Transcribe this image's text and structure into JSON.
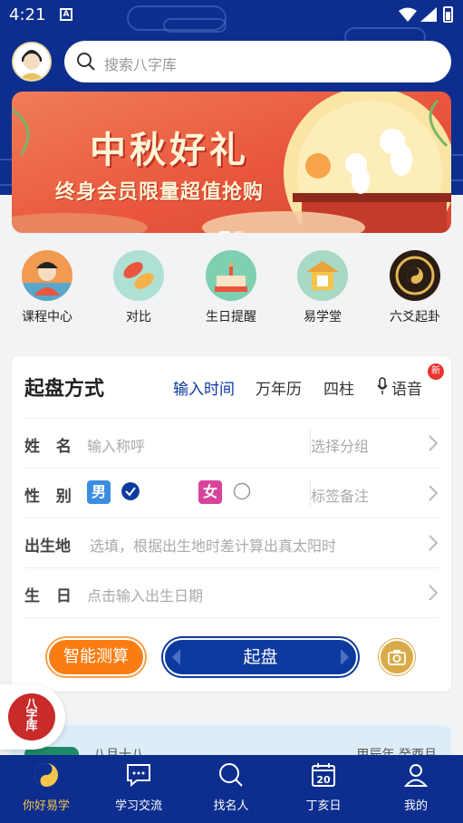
{
  "status": {
    "time": "4:21"
  },
  "search": {
    "placeholder": "搜索八字库"
  },
  "banner": {
    "title": "中秋好礼",
    "subtitle": "终身会员限量超值抢购"
  },
  "shortcuts": [
    {
      "label": "课程中心",
      "icon": "teacher-icon"
    },
    {
      "label": "对比",
      "icon": "koi-fish-icon"
    },
    {
      "label": "生日提醒",
      "icon": "birthday-cake-icon"
    },
    {
      "label": "易学堂",
      "icon": "temple-icon"
    },
    {
      "label": "六爻起卦",
      "icon": "bagua-icon"
    }
  ],
  "form": {
    "title": "起盘方式",
    "tabs": [
      "输入时间",
      "万年历",
      "四柱",
      "语音"
    ],
    "active_tab": "输入时间",
    "new_badge": "新",
    "name_label": "姓 名",
    "name_placeholder": "输入称呼",
    "group_placeholder": "选择分组",
    "gender_label": "性 别",
    "male": "男",
    "female": "女",
    "selected_gender": "男",
    "tag_placeholder": "标签备注",
    "birthplace_label": "出生地",
    "birthplace_placeholder": "选填，根据出生地时差计算出真太阳时",
    "birthday_label": "生 日",
    "birthday_placeholder": "点击输入出生日期",
    "smart_button": "智能测算",
    "start_button": "起盘"
  },
  "float_logo": {
    "line1": "八",
    "line2": "字",
    "line3": "库"
  },
  "calendar_strip": {
    "left": "八月十八",
    "right": "甲辰年 癸酉月"
  },
  "tabbar": [
    {
      "label": "你好易学",
      "active": true
    },
    {
      "label": "学习交流",
      "active": false
    },
    {
      "label": "找名人",
      "active": false
    },
    {
      "label": "丁亥日",
      "active": false,
      "date": "20"
    },
    {
      "label": "我的",
      "active": false
    }
  ],
  "colors": {
    "brand_blue": "#0d2e8f",
    "accent_orange": "#fb7d11",
    "gold": "#f3c64a",
    "male_blue": "#3b8de0",
    "female_pink": "#d7449a"
  }
}
